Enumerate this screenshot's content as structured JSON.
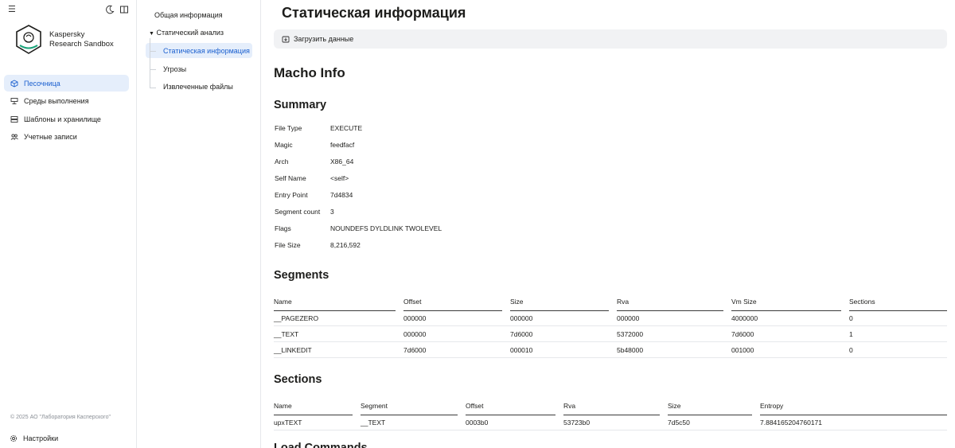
{
  "app": {
    "brand_line1": "Kaspersky",
    "brand_line2": "Research Sandbox",
    "copyright": "© 2025 АО \"Лаборатория Касперского\"",
    "settings_label": "Настройки"
  },
  "sidebar": {
    "items": [
      {
        "label": "Песочница",
        "icon": "cube-icon",
        "active": true
      },
      {
        "label": "Среды выполнения",
        "icon": "environment-icon",
        "active": false
      },
      {
        "label": "Шаблоны и хранилище",
        "icon": "storage-icon",
        "active": false
      },
      {
        "label": "Учетные записи",
        "icon": "users-icon",
        "active": false
      }
    ]
  },
  "subnav": {
    "general": "Общая информация",
    "static_analysis": "Статический анализ",
    "static_info": "Статическая информация",
    "threats": "Угрозы",
    "extracted_files": "Извлеченные файлы"
  },
  "main": {
    "title": "Статическая информация",
    "upload_label": "Загрузить данные",
    "macho_title": "Macho Info",
    "summary_title": "Summary",
    "segments_title": "Segments",
    "sections_title": "Sections",
    "next_title": "Load Commands"
  },
  "summary": [
    {
      "k": "File Type",
      "v": "EXECUTE"
    },
    {
      "k": "Magic",
      "v": "feedfacf"
    },
    {
      "k": "Arch",
      "v": "X86_64"
    },
    {
      "k": "Self Name",
      "v": "<self>"
    },
    {
      "k": "Entry Point",
      "v": "7d4834"
    },
    {
      "k": "Segment count",
      "v": "3"
    },
    {
      "k": "Flags",
      "v": "NOUNDEFS DYLDLINK TWOLEVEL"
    },
    {
      "k": "File Size",
      "v": "8,216,592"
    }
  ],
  "segments": {
    "headers": [
      "Name",
      "Offset",
      "Size",
      "Rva",
      "Vm Size",
      "Sections"
    ],
    "rows": [
      [
        "__PAGEZERO",
        "000000",
        "000000",
        "000000",
        "4000000",
        "0"
      ],
      [
        "__TEXT",
        "000000",
        "7d6000",
        "5372000",
        "7d6000",
        "1"
      ],
      [
        "__LINKEDIT",
        "7d6000",
        "000010",
        "5b48000",
        "001000",
        "0"
      ]
    ]
  },
  "sections": {
    "headers": [
      "Name",
      "Segment",
      "Offset",
      "Rva",
      "Size",
      "Entropy"
    ],
    "rows": [
      [
        "upxTEXT",
        "__TEXT",
        "0003b0",
        "53723b0",
        "7d5c50",
        "7.884165204760171"
      ]
    ]
  },
  "colors": {
    "accent": "#1a5fcf",
    "active_bg": "#e5eefb",
    "toolbar_bg": "#f1f2f4"
  }
}
